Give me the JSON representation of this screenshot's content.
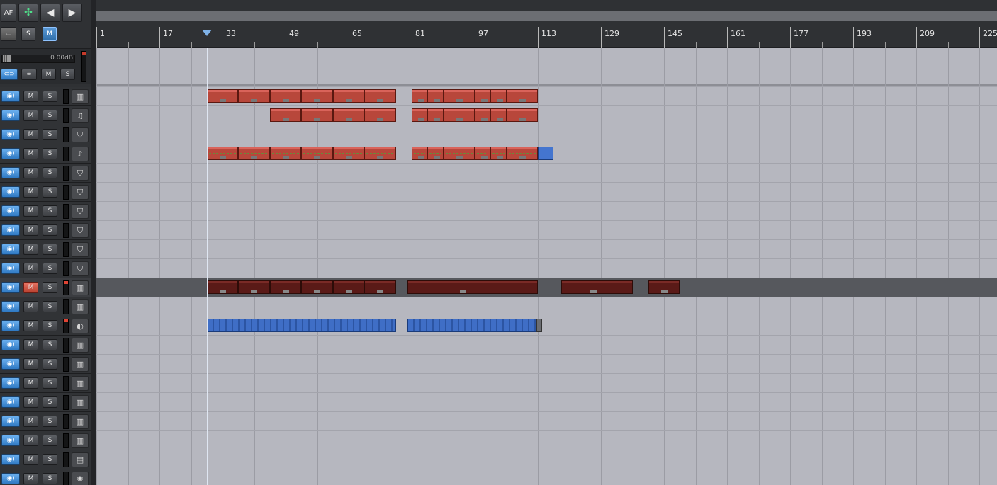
{
  "toolbar": {
    "af_label": "AF",
    "solo_label": "S",
    "mute_label": "M"
  },
  "master": {
    "volume": "0.00dB",
    "mute_label": "M",
    "solo_label": "S"
  },
  "ruler_labels": [
    "1",
    "17",
    "33",
    "49",
    "65",
    "81",
    "97",
    "113",
    "129",
    "145",
    "161",
    "177",
    "193",
    "209",
    "225"
  ],
  "tracks": [
    {
      "mute": "M",
      "solo": "S",
      "icon": "keyboard-icon",
      "glyph": "▥",
      "mute_on": false
    },
    {
      "mute": "M",
      "solo": "S",
      "icon": "bass-guitar-icon",
      "glyph": "♫",
      "mute_on": false
    },
    {
      "mute": "M",
      "solo": "S",
      "icon": "shield-icon",
      "glyph": "⛉",
      "mute_on": false
    },
    {
      "mute": "M",
      "solo": "S",
      "icon": "guitar-icon",
      "glyph": "♪",
      "mute_on": false
    },
    {
      "mute": "M",
      "solo": "S",
      "icon": "shield-icon",
      "glyph": "⛉",
      "mute_on": false
    },
    {
      "mute": "M",
      "solo": "S",
      "icon": "shield-icon",
      "glyph": "⛉",
      "mute_on": false
    },
    {
      "mute": "M",
      "solo": "S",
      "icon": "shield-icon",
      "glyph": "⛉",
      "mute_on": false
    },
    {
      "mute": "M",
      "solo": "S",
      "icon": "shield-icon",
      "glyph": "⛉",
      "mute_on": false
    },
    {
      "mute": "M",
      "solo": "S",
      "icon": "shield-icon",
      "glyph": "⛉",
      "mute_on": false
    },
    {
      "mute": "M",
      "solo": "S",
      "icon": "shield-icon",
      "glyph": "⛉",
      "mute_on": false
    },
    {
      "mute": "M",
      "solo": "S",
      "icon": "keyboard-icon",
      "glyph": "▥",
      "mute_on": true
    },
    {
      "mute": "M",
      "solo": "S",
      "icon": "keyboard-icon",
      "glyph": "▥",
      "mute_on": false
    },
    {
      "mute": "M",
      "solo": "S",
      "icon": "drum-icon",
      "glyph": "◐",
      "mute_on": false
    },
    {
      "mute": "M",
      "solo": "S",
      "icon": "keyboard-icon",
      "glyph": "▥",
      "mute_on": false
    },
    {
      "mute": "M",
      "solo": "S",
      "icon": "keyboard-icon",
      "glyph": "▥",
      "mute_on": false
    },
    {
      "mute": "M",
      "solo": "S",
      "icon": "keyboard-icon",
      "glyph": "▥",
      "mute_on": false
    },
    {
      "mute": "M",
      "solo": "S",
      "icon": "keyboard-icon",
      "glyph": "▥",
      "mute_on": false
    },
    {
      "mute": "M",
      "solo": "S",
      "icon": "keyboard-icon",
      "glyph": "▥",
      "mute_on": false
    },
    {
      "mute": "M",
      "solo": "S",
      "icon": "keyboard-icon",
      "glyph": "▥",
      "mute_on": false
    },
    {
      "mute": "M",
      "solo": "S",
      "icon": "amp-icon",
      "glyph": "▤",
      "mute_on": false
    },
    {
      "mute": "M",
      "solo": "S",
      "icon": "drumkit-icon",
      "glyph": "✺",
      "mute_on": false
    }
  ],
  "colors": {
    "clip_red": "#b8473b",
    "clip_dark": "#5a1a17",
    "clip_blue": "#3f6ec6",
    "selected_track": "#56585d",
    "mute_active": "#d55a48"
  },
  "clip_rows": [
    {
      "track": 0,
      "kind": "red",
      "bars": [
        [
          29,
          37
        ],
        [
          37,
          45
        ],
        [
          45,
          53
        ],
        [
          53,
          61
        ],
        [
          61,
          69
        ],
        [
          69,
          77
        ],
        [
          81,
          85
        ],
        [
          85,
          89
        ],
        [
          89,
          97
        ],
        [
          97,
          101
        ],
        [
          101,
          105
        ],
        [
          105,
          113
        ]
      ]
    },
    {
      "track": 1,
      "kind": "red",
      "bars": [
        [
          45,
          53
        ],
        [
          53,
          61
        ],
        [
          61,
          69
        ],
        [
          69,
          77
        ],
        [
          81,
          85
        ],
        [
          85,
          89
        ],
        [
          89,
          97
        ],
        [
          97,
          101
        ],
        [
          101,
          105
        ],
        [
          105,
          113
        ]
      ]
    },
    {
      "track": 3,
      "kind": "red",
      "bars": [
        [
          29,
          37
        ],
        [
          37,
          45
        ],
        [
          45,
          53
        ],
        [
          53,
          61
        ],
        [
          61,
          69
        ],
        [
          69,
          77
        ],
        [
          81,
          85
        ],
        [
          85,
          89
        ],
        [
          89,
          97
        ],
        [
          97,
          101
        ],
        [
          101,
          105
        ],
        [
          105,
          113
        ]
      ]
    },
    {
      "track": 3,
      "kind": "blue",
      "bars": [
        [
          113,
          117
        ]
      ]
    },
    {
      "track": 10,
      "kind": "dark",
      "bars": [
        [
          29,
          37
        ],
        [
          37,
          45
        ],
        [
          45,
          53
        ],
        [
          53,
          61
        ],
        [
          61,
          69
        ],
        [
          69,
          77
        ],
        [
          80,
          113
        ],
        [
          119,
          137
        ],
        [
          141,
          149
        ]
      ]
    },
    {
      "track": 12,
      "kind": "blue-pattern",
      "bars": [
        [
          29,
          77
        ],
        [
          80,
          114
        ]
      ]
    }
  ],
  "playhead_bar": 29
}
